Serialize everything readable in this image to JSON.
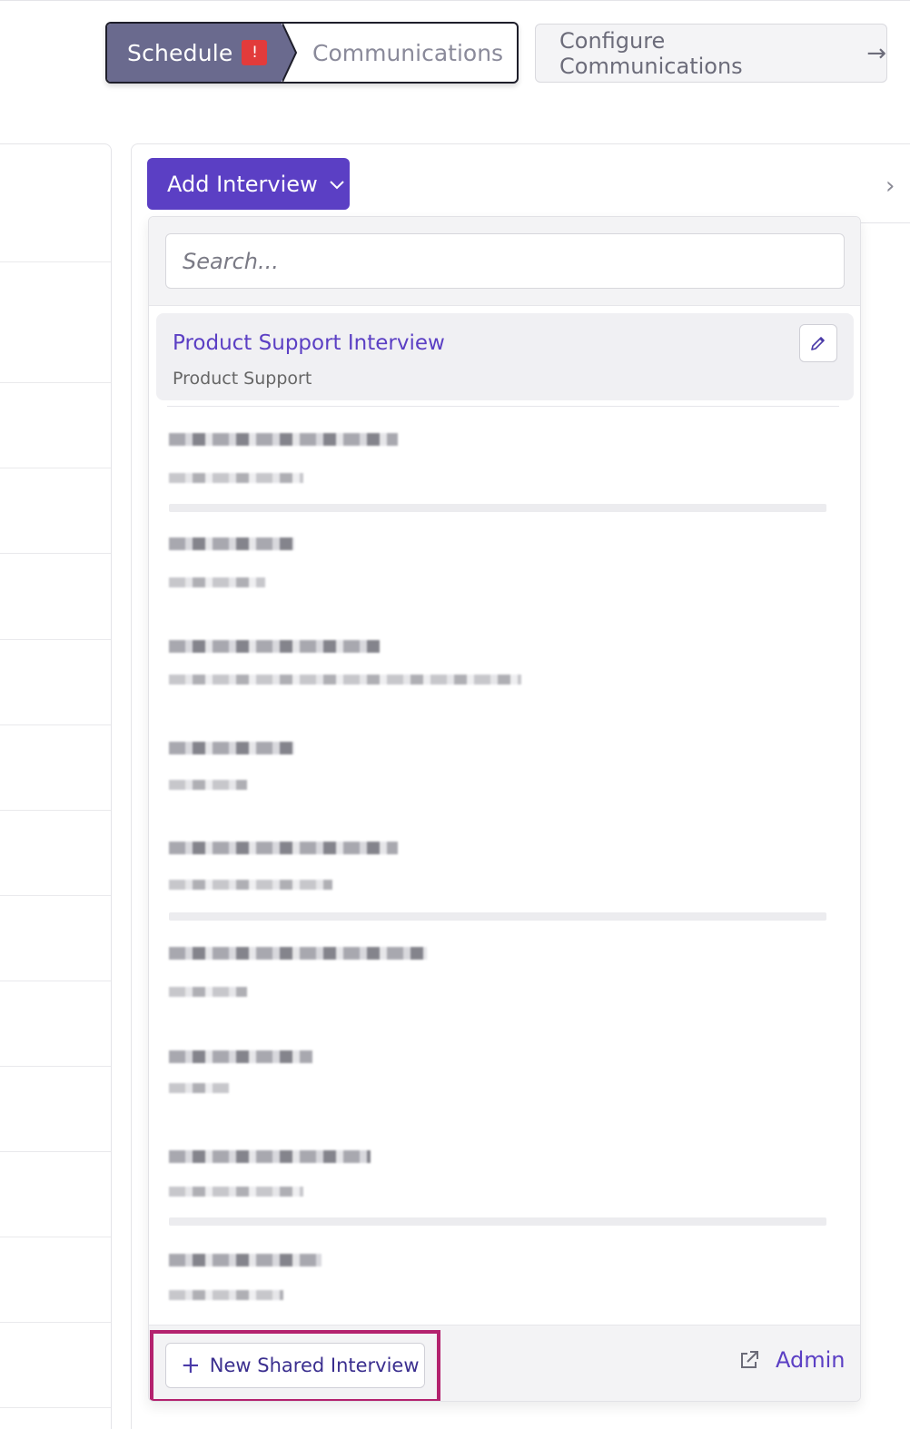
{
  "stepper": {
    "schedule_label": "Schedule",
    "alert_badge": "!",
    "communications_label": "Communications"
  },
  "configure": {
    "label": "Configure Communications",
    "arrow": "→"
  },
  "panel": {
    "chevron": "›"
  },
  "add_interview": {
    "label": "Add Interview",
    "chevron": "⌵"
  },
  "dropdown": {
    "search_placeholder": "Search...",
    "selected_item": {
      "title": "Product Support Interview",
      "subtitle": "Product Support",
      "edit_icon": "pencil-icon"
    },
    "redacted_item_count": 9,
    "footer": {
      "new_shared_label": "New Shared Interview",
      "plus": "+",
      "admin_label": "Admin",
      "admin_icon": "external-link-icon"
    }
  },
  "colors": {
    "accent": "#5b3fc4",
    "step_active": "#6a6a8e",
    "alert": "#e23b3b",
    "highlight": "#b3226e"
  }
}
